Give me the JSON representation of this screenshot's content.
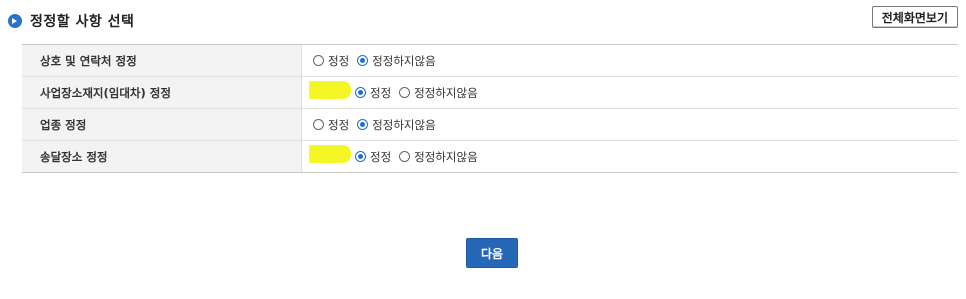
{
  "header": {
    "title": "정정할 사항 선택",
    "fullscreen_label": "전체화면보기"
  },
  "rows": [
    {
      "label": "상호 및 연락처 정정",
      "options": [
        "정정",
        "정정하지않음"
      ],
      "selected": 1,
      "highlighted": false
    },
    {
      "label": "사업장소재지(임대차) 정정",
      "options": [
        "정정",
        "정정하지않음"
      ],
      "selected": 0,
      "highlighted": true
    },
    {
      "label": "업종 정정",
      "options": [
        "정정",
        "정정하지않음"
      ],
      "selected": 1,
      "highlighted": false
    },
    {
      "label": "송달장소 정정",
      "options": [
        "정정",
        "정정하지않음"
      ],
      "selected": 0,
      "highlighted": true
    }
  ],
  "footer": {
    "next_label": "다음"
  },
  "colors": {
    "accent": "#2767b8",
    "highlight": "#f2f500"
  }
}
